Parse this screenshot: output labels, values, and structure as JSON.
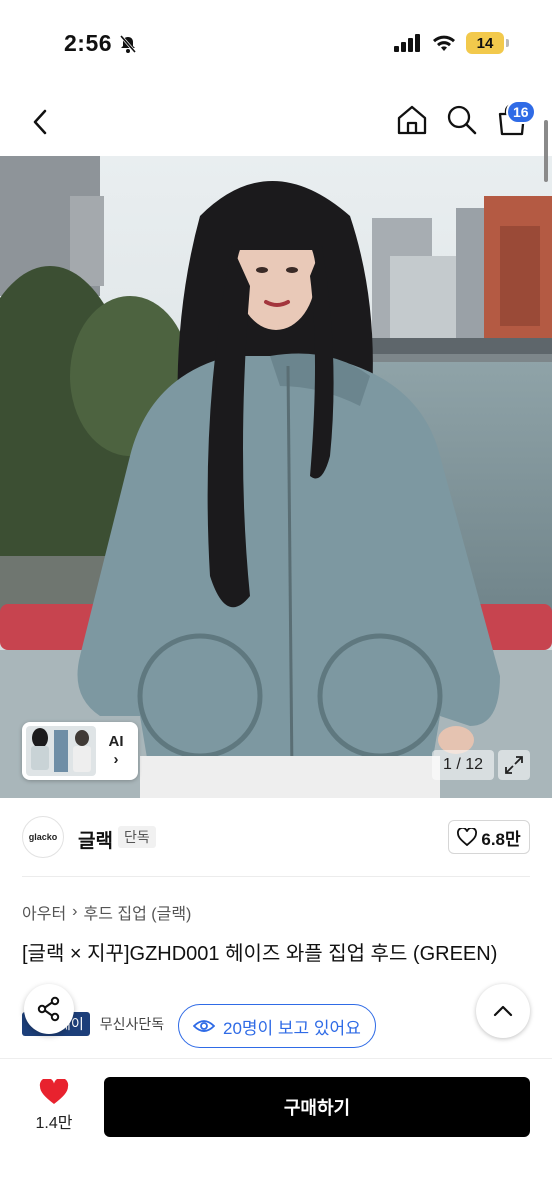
{
  "status_bar": {
    "time": "2:56",
    "battery": "14"
  },
  "nav": {
    "cart_count": "16"
  },
  "gallery": {
    "ai_label": "AI",
    "ai_chevron": "›",
    "counter": "1 / 12"
  },
  "brand": {
    "logo_text": "glacko",
    "name": "글랙",
    "tag": "단독",
    "likes": "6.8만"
  },
  "product": {
    "breadcrumb": [
      "아우터",
      "후드 집업 (글랙)"
    ],
    "title": "[글랙 × 지꾸]GZHD001 헤이즈 와플 집업 후드 (GREEN)",
    "badge_dark": "페이",
    "badge_light": "무신사단독",
    "viewers": "20명이 보고 있어요"
  },
  "bottom": {
    "wish_count": "1.4만",
    "buy_label": "구매하기"
  },
  "colors": {
    "accent_blue": "#2f6be6",
    "heart_red": "#e8222e",
    "badge_navy": "#1d3f7a"
  },
  "icons": [
    "back-arrow-icon",
    "home-icon",
    "search-icon",
    "cart-icon",
    "bell-slash-icon",
    "signal-icon",
    "wifi-icon",
    "heart-icon",
    "share-icon",
    "eye-icon",
    "chevron-up-icon",
    "expand-icon"
  ]
}
